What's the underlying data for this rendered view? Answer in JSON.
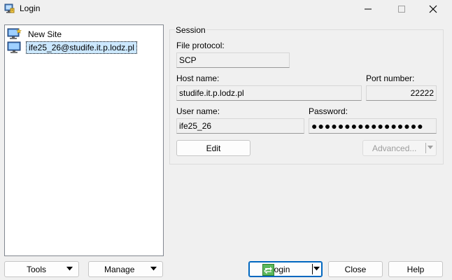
{
  "window": {
    "title": "Login"
  },
  "sites": [
    {
      "label": "New Site"
    },
    {
      "label": "ife25_26@studife.it.p.lodz.pl"
    }
  ],
  "session": {
    "group_label": "Session",
    "file_protocol_label": "File protocol:",
    "file_protocol_value": "SCP",
    "host_name_label": "Host name:",
    "host_name_value": "studife.it.p.lodz.pl",
    "port_number_label": "Port number:",
    "port_number_value": "22222",
    "user_name_label": "User name:",
    "user_name_value": "ife25_26",
    "password_label": "Password:",
    "password_value": "●●●●●●●●●●●●●●●●●",
    "edit_label": "Edit",
    "advanced_label": "Advanced..."
  },
  "buttons": {
    "tools_label": "Tools",
    "manage_label": "Manage",
    "login_label": "Login",
    "close_label": "Close",
    "help_label": "Help"
  },
  "colors": {
    "accent": "#0067c0",
    "selection": "#cce8ff"
  }
}
